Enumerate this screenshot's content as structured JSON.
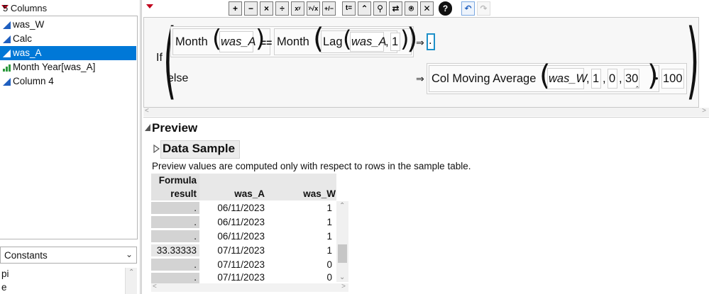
{
  "columns_panel": {
    "header": "5 Columns",
    "items": [
      {
        "label": "was_W",
        "type": "continuous",
        "selected": false
      },
      {
        "label": "Calc",
        "type": "continuous",
        "selected": false
      },
      {
        "label": "was_A",
        "type": "continuous",
        "selected": true
      },
      {
        "label": "Month Year[was_A]",
        "type": "ordinal",
        "selected": false
      },
      {
        "label": "Column 4",
        "type": "continuous",
        "selected": false
      }
    ]
  },
  "functions_panel": {
    "selected": "Constants",
    "items": [
      "pi",
      "e"
    ]
  },
  "toolbar": {
    "buttons": [
      {
        "name": "add",
        "glyph": "+"
      },
      {
        "name": "subtract",
        "glyph": "−"
      },
      {
        "name": "multiply",
        "glyph": "×"
      },
      {
        "name": "divide",
        "glyph": "÷"
      },
      {
        "name": "power",
        "glyph": "xʸ"
      },
      {
        "name": "root",
        "glyph": "ʸ√x"
      },
      {
        "name": "negate",
        "glyph": "+/−"
      },
      {
        "name": "local-variable",
        "glyph": "t="
      },
      {
        "name": "peel",
        "glyph": "⌃"
      },
      {
        "name": "unwrap",
        "glyph": "⚲"
      },
      {
        "name": "swap",
        "glyph": "⇄"
      },
      {
        "name": "unary",
        "glyph": "⍟"
      },
      {
        "name": "delete",
        "glyph": "✕"
      },
      {
        "name": "help",
        "glyph": "?"
      },
      {
        "name": "undo",
        "glyph": "↶"
      },
      {
        "name": "redo",
        "glyph": "↷"
      }
    ]
  },
  "formula": {
    "if_keyword": "If",
    "else_keyword": "else",
    "cond_fn1": "Month",
    "cond_arg1": "was_A",
    "equals_op": "==",
    "cond_fn2": "Month",
    "lag_fn": "Lag",
    "lag_arg": "was_A",
    "comma": ",",
    "lag_n": "1",
    "arrow": "⇒",
    "then_value": ".",
    "else_fn": "Col Moving Average",
    "else_arg1": "was_W",
    "else_arg2": "1",
    "else_arg3": "0",
    "else_arg4": "30",
    "mult_op": "•",
    "else_mult": "100"
  },
  "preview": {
    "title": "Preview",
    "data_sample_title": "Data Sample",
    "note": "Preview values are computed only with respect to rows in the sample table.",
    "headers": {
      "formula_line1": "Formula",
      "formula_line2": "result",
      "col_a": "was_A",
      "col_w": "was_W"
    },
    "rows": [
      {
        "result": ".",
        "was_A": "06/11/2023",
        "was_W": "1"
      },
      {
        "result": ".",
        "was_A": "06/11/2023",
        "was_W": "1"
      },
      {
        "result": ".",
        "was_A": "06/11/2023",
        "was_W": "1"
      },
      {
        "result": "33.33333",
        "was_A": "07/11/2023",
        "was_W": "1"
      },
      {
        "result": ".",
        "was_A": "07/11/2023",
        "was_W": "0"
      },
      {
        "result": ".",
        "was_A": "07/11/2023",
        "was_W": "0"
      }
    ]
  },
  "colors": {
    "selection": "#0078d7",
    "continuous_icon": "#1f5fbf",
    "ordinal_icon": "#2e9a3e",
    "red_menu": "#c0001c"
  }
}
